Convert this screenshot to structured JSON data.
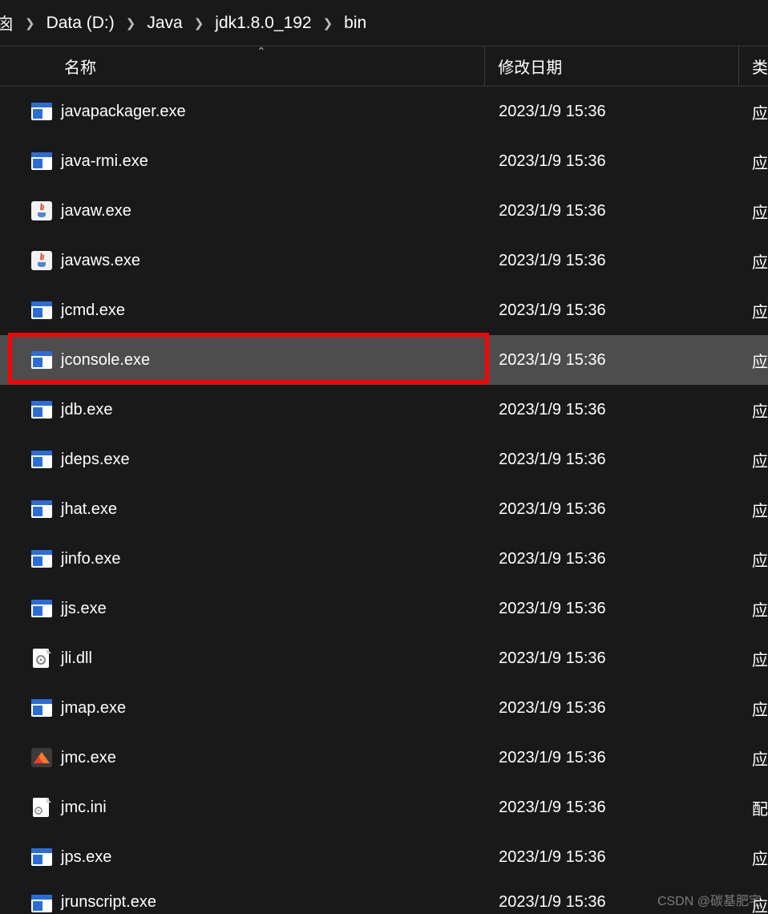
{
  "breadcrumb": {
    "items": [
      "Data (D:)",
      "Java",
      "jdk1.8.0_192",
      "bin"
    ]
  },
  "columns": {
    "name": "名称",
    "date": "修改日期",
    "type": "类"
  },
  "files": [
    {
      "name": "javapackager.exe",
      "date": "2023/1/9 15:36",
      "type": "应",
      "icon": "exe",
      "selected": false
    },
    {
      "name": "java-rmi.exe",
      "date": "2023/1/9 15:36",
      "type": "应",
      "icon": "exe",
      "selected": false
    },
    {
      "name": "javaw.exe",
      "date": "2023/1/9 15:36",
      "type": "应",
      "icon": "java",
      "selected": false
    },
    {
      "name": "javaws.exe",
      "date": "2023/1/9 15:36",
      "type": "应",
      "icon": "java",
      "selected": false
    },
    {
      "name": "jcmd.exe",
      "date": "2023/1/9 15:36",
      "type": "应",
      "icon": "exe",
      "selected": false
    },
    {
      "name": "jconsole.exe",
      "date": "2023/1/9 15:36",
      "type": "应",
      "icon": "exe",
      "selected": true
    },
    {
      "name": "jdb.exe",
      "date": "2023/1/9 15:36",
      "type": "应",
      "icon": "exe",
      "selected": false
    },
    {
      "name": "jdeps.exe",
      "date": "2023/1/9 15:36",
      "type": "应",
      "icon": "exe",
      "selected": false
    },
    {
      "name": "jhat.exe",
      "date": "2023/1/9 15:36",
      "type": "应",
      "icon": "exe",
      "selected": false
    },
    {
      "name": "jinfo.exe",
      "date": "2023/1/9 15:36",
      "type": "应",
      "icon": "exe",
      "selected": false
    },
    {
      "name": "jjs.exe",
      "date": "2023/1/9 15:36",
      "type": "应",
      "icon": "exe",
      "selected": false
    },
    {
      "name": "jli.dll",
      "date": "2023/1/9 15:36",
      "type": "应",
      "icon": "dll",
      "selected": false
    },
    {
      "name": "jmap.exe",
      "date": "2023/1/9 15:36",
      "type": "应",
      "icon": "exe",
      "selected": false
    },
    {
      "name": "jmc.exe",
      "date": "2023/1/9 15:36",
      "type": "应",
      "icon": "jmc",
      "selected": false
    },
    {
      "name": "jmc.ini",
      "date": "2023/1/9 15:36",
      "type": "配",
      "icon": "ini",
      "selected": false
    },
    {
      "name": "jps.exe",
      "date": "2023/1/9 15:36",
      "type": "应",
      "icon": "exe",
      "selected": false
    },
    {
      "name": "jrunscript.exe",
      "date": "2023/1/9 15:36",
      "type": "应",
      "icon": "exe",
      "selected": false
    }
  ],
  "watermark": "CSDN @碳基肥宅"
}
